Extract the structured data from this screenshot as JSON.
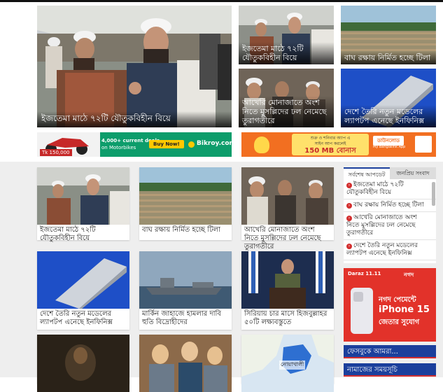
{
  "hero": {
    "main_title": "ইজতেমা মাঠে ৭২টি যৌতুকবিহীন বিয়ে",
    "small": [
      {
        "title": "ইজতেমা মাঠে ৭২টি যৌতুকবিহীন বিয়ে"
      },
      {
        "title": "বাঘ রক্ষায় নির্মিত হচ্ছে টিলা"
      },
      {
        "title": "আখেরি মোনাজাতে অংশ নিতে মুসল্লিদের ঢল নেমেছে তুরাগতীরে"
      },
      {
        "title": "দেশে তৈরি নতুন মডেলের ল্যাপটপ এনেছে ইনফিনিক্স"
      }
    ]
  },
  "ads": {
    "bikroy": {
      "price": "Tk 150,000",
      "deal_line1": "4,000+ current deals",
      "deal_line2": "on Motorbikes",
      "button": "Buy Now!",
      "brand": "Bikroy.com"
    },
    "banglalink": {
      "line1": "শুক্র ও শনিবার অ্যাপ এ",
      "line2": "সাইন আপ করলেই",
      "highlight": "150 MB বোনাস",
      "button": "ডাউনলোড",
      "button_sub": "My Banglalink App"
    },
    "side": {
      "tag1": "Daraz 11.11",
      "tag2": "নগদ",
      "line1": "নগদ পেমেন্টে",
      "line2": "iPhone 15",
      "line3": "জেতার সুযোগ"
    }
  },
  "grid": [
    {
      "title": "ইজতেমা মাঠে ৭২টি যৌতুকবিহীন বিয়ে"
    },
    {
      "title": "বাঘ রক্ষায় নির্মিত হচ্ছে টিলা"
    },
    {
      "title": "আখেরি মোনাজাতে অংশ নিতে মুসল্লিদের ঢল নেমেছে তুরাগতীরে"
    },
    {
      "title": "দেশে তৈরি নতুন মডেলের ল্যাপটপ এনেছে ইনফিনিক্স"
    },
    {
      "title": "মার্কিন জাহাজে হামলার দাবি হুতি বিদ্রোহীদের"
    },
    {
      "title": "সিরিয়ায় চার মাসে হিজবুল্লাহর ৫০টি লক্ষ্যবস্তুতে"
    },
    {
      "title": ""
    },
    {
      "title": ""
    },
    {
      "title": ""
    }
  ],
  "map_label": "নোয়াখালী",
  "sidebar": {
    "tab_latest": "সর্বশেষ আপডেট",
    "tab_popular": "জনপ্রিয় সংবাদ",
    "feed": [
      "ইজতেমা মাঠে ৭২টি যৌতুকবিহীন বিয়ে",
      "বাঘ রক্ষায় নির্মিত হচ্ছে টিলা",
      "আখেরি মোনাজাতে অংশ নিতে মুসল্লিদের ঢল নেমেছে তুরাগতীরে",
      "দেশে তৈরি নতুন মডেলের ল্যাপটপ এনেছে ইনফিনিক্স"
    ],
    "facebook_heading": "ফেসবুকে আমরা...",
    "prayer_heading": "নামাজের সময়সূচি"
  }
}
